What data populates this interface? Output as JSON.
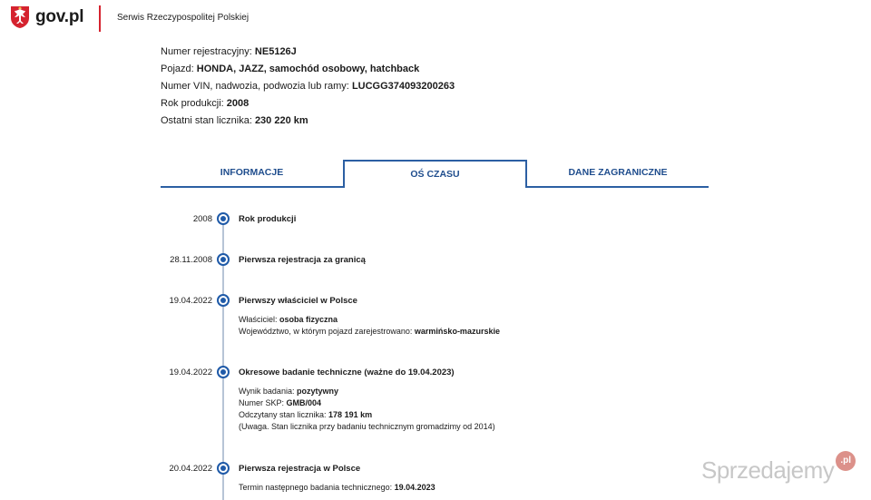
{
  "header": {
    "logo_text": "gov.pl",
    "service_name": "Serwis Rzeczypospolitej Polskiej"
  },
  "vehicle": {
    "rows": [
      {
        "label": "Numer rejestracyjny: ",
        "value": "NE5126J"
      },
      {
        "label": "Pojazd: ",
        "value": "HONDA, JAZZ, samochód osobowy, hatchback"
      },
      {
        "label": "Numer VIN, nadwozia, podwozia lub ramy: ",
        "value": "LUCGG374093200263"
      },
      {
        "label": "Rok produkcji: ",
        "value": "2008"
      },
      {
        "label": "Ostatni stan licznika: ",
        "value": "230 220 km"
      }
    ]
  },
  "tabs": [
    {
      "label": "INFORMACJE",
      "active": false
    },
    {
      "label": "OŚ CZASU",
      "active": true
    },
    {
      "label": "DANE ZAGRANICZNE",
      "active": false
    }
  ],
  "timeline": [
    {
      "date": "2008",
      "title": "Rok produkcji",
      "details": []
    },
    {
      "date": "28.11.2008",
      "title": "Pierwsza rejestracja za granicą",
      "details": []
    },
    {
      "date": "19.04.2022",
      "title": "Pierwszy właściciel w Polsce",
      "details": [
        {
          "label": "Właściciel: ",
          "value": "osoba fizyczna"
        },
        {
          "label": "Województwo, w którym pojazd zarejestrowano: ",
          "value": "warmińsko-mazurskie"
        }
      ]
    },
    {
      "date": "19.04.2022",
      "title": "Okresowe badanie techniczne (ważne do 19.04.2023)",
      "details": [
        {
          "label": "Wynik badania: ",
          "value": "pozytywny"
        },
        {
          "label": "Numer SKP: ",
          "value": "GMB/004"
        },
        {
          "label": "Odczytany stan licznika: ",
          "value": "178 191 km"
        },
        {
          "label": "(Uwaga. Stan licznika przy badaniu technicznym gromadzimy od 2014)",
          "value": ""
        }
      ]
    },
    {
      "date": "20.04.2022",
      "title": "Pierwsza rejestracja w Polsce",
      "details": [
        {
          "label": "Termin następnego badania technicznego: ",
          "value": "19.04.2023"
        }
      ]
    }
  ],
  "watermark": {
    "text": "Sprzedajemy",
    "badge": ".pl"
  },
  "colors": {
    "accent": "#1f5aa8",
    "tab_text": "#1f4d8d",
    "header_divider": "#d5232f"
  }
}
